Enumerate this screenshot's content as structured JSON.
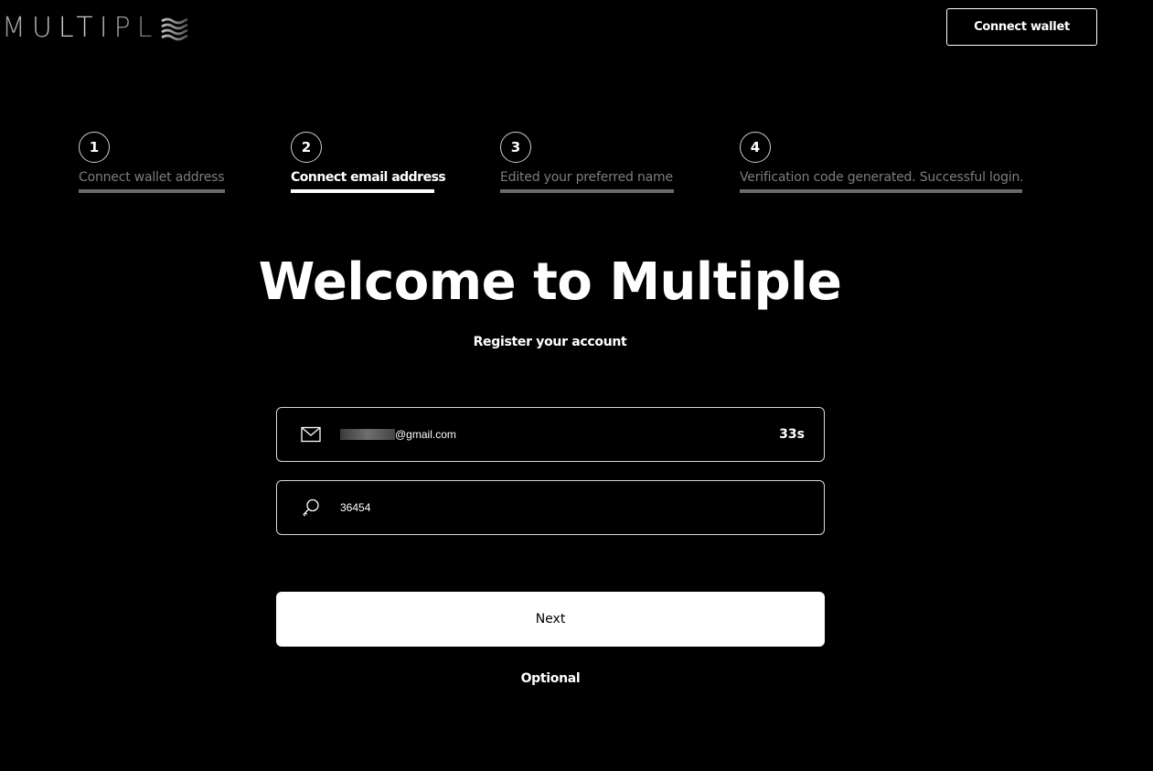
{
  "header": {
    "logo_text": "MULTIPL",
    "connect_wallet_label": "Connect wallet"
  },
  "steps": [
    {
      "number": "1",
      "label": "Connect wallet address",
      "active": false
    },
    {
      "number": "2",
      "label": "Connect email address",
      "active": true
    },
    {
      "number": "3",
      "label": "Edited your preferred name",
      "active": false
    },
    {
      "number": "4",
      "label": "Verification code generated. Successful login.",
      "active": false
    }
  ],
  "main": {
    "title": "Welcome to Multiple",
    "subtitle": "Register your account",
    "email_field": {
      "value_suffix": "@gmail.com",
      "countdown": "33s",
      "icon": "mail-icon"
    },
    "code_field": {
      "value": "36454",
      "icon": "key-icon"
    },
    "next_label": "Next",
    "optional_label": "Optional"
  },
  "colors": {
    "background": "#000000",
    "text": "#ffffff",
    "inactive_step": "#7d7d7d",
    "inactive_bar": "#6a6a6a"
  }
}
